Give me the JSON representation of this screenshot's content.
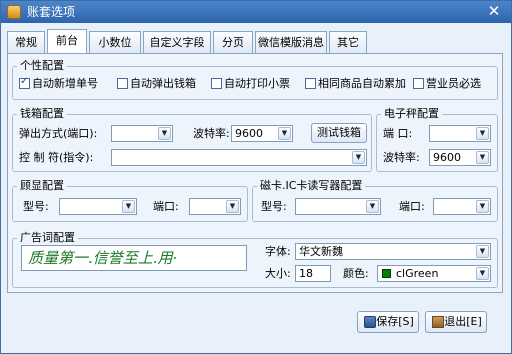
{
  "window": {
    "title": "账套选项",
    "close_glyph": "✕"
  },
  "tabs": [
    {
      "label": "常规"
    },
    {
      "label": "前台"
    },
    {
      "label": "小数位"
    },
    {
      "label": "自定义字段"
    },
    {
      "label": "分页"
    },
    {
      "label": "微信模版消息"
    },
    {
      "label": "其它"
    }
  ],
  "active_tab": "前台",
  "personal": {
    "title": "个性配置",
    "options": [
      {
        "label": "自动新增单号",
        "checked": true
      },
      {
        "label": "自动弹出钱箱",
        "checked": false
      },
      {
        "label": "自动打印小票",
        "checked": false
      },
      {
        "label": "相同商品自动累加",
        "checked": false
      },
      {
        "label": "营业员必选",
        "checked": false
      }
    ]
  },
  "cashbox": {
    "title": "钱箱配置",
    "popup_label": "弹出方式(端口):",
    "popup_value": "",
    "baud_label": "波特率:",
    "baud_value": "9600",
    "test_button": "测试钱箱",
    "control_label": "控 制 符(指令):",
    "control_value": ""
  },
  "scale": {
    "title": "电子秤配置",
    "port_label": "端  口:",
    "port_value": "",
    "baud_label": "波特率:",
    "baud_value": "9600"
  },
  "display": {
    "title": "顾显配置",
    "model_label": "型号:",
    "model_value": "",
    "port_label": "端口:",
    "port_value": ""
  },
  "card": {
    "title": "磁卡.IC卡读写器配置",
    "model_label": "型号:",
    "model_value": "",
    "port_label": "端口:",
    "port_value": ""
  },
  "ad": {
    "title": "广告词配置",
    "text": "质量第一.信誉至上.用·",
    "font_label": "字体:",
    "font_value": "华文新魏",
    "size_label": "大小:",
    "size_value": "18",
    "color_label": "颜色:",
    "color_value": "clGreen",
    "color_hex": "#008000"
  },
  "footer": {
    "save_button": "保存[S]",
    "exit_button": "退出[E]"
  },
  "colors": {
    "accent": "#2d64ad",
    "panel": "#eef4fb",
    "ad_text": "#1a7a2a"
  }
}
